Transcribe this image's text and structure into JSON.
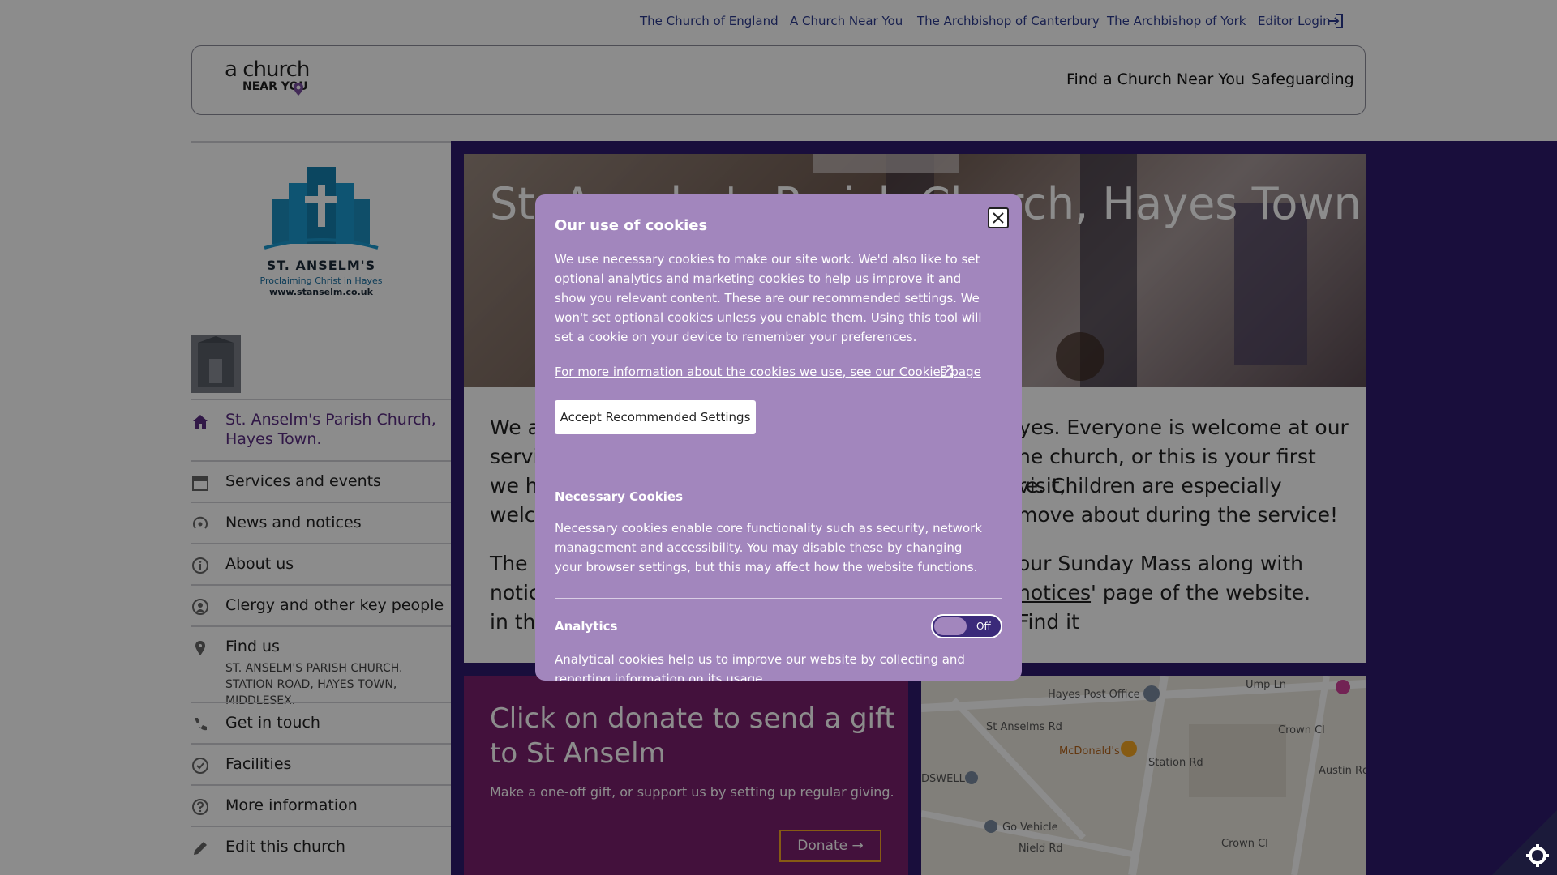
{
  "utility_nav": {
    "links": [
      "The Church of England",
      "A Church Near You",
      "The Archbishop of Canterbury",
      "The Archbishop of York",
      "Editor Login"
    ]
  },
  "header": {
    "brand_line1": "a church",
    "brand_line2": "NEAR YOU",
    "nav": [
      "Find a Church Near You",
      "Safeguarding"
    ]
  },
  "church_logo": {
    "name": "ST. ANSELM'S",
    "tagline": "Proclaiming Christ in Hayes",
    "website": "www.stanselm.co.uk"
  },
  "sidebar": {
    "items": [
      {
        "label": "St. Anselm's Parish Church, Hayes Town.",
        "icon": "home-icon"
      },
      {
        "label": "Services and events",
        "icon": "calendar-icon"
      },
      {
        "label": "News and notices",
        "icon": "broadcast-icon"
      },
      {
        "label": "About us",
        "icon": "info-icon"
      },
      {
        "label": "Clergy and other key people",
        "icon": "person-icon"
      },
      {
        "label": "Find us",
        "icon": "map-pin-icon",
        "sub": "ST. ANSELM'S PARISH CHURCH. STATION ROAD, HAYES TOWN, MIDDLESEX."
      },
      {
        "label": "Get in touch",
        "icon": "phone-icon"
      },
      {
        "label": "Facilities",
        "icon": "check-circle-icon"
      },
      {
        "label": "More information",
        "icon": "question-icon"
      },
      {
        "label": "Edit this church",
        "icon": "pencil-icon"
      }
    ]
  },
  "hero": {
    "title": "St. Anselm's Parish Church, Hayes Town."
  },
  "intro": {
    "p1_visible_left": "We a",
    "p1_line2_left": "servi",
    "p1_line3_left": "we ho",
    "p1_line4_left": "welco",
    "p1_right_1": "Hayes. Everyone is welcome at our",
    "p1_right_2": "he church, or this is your first visit,",
    "p1_right_3": "re. Children are especially",
    "p1_right_4": "move about during the service!",
    "p2_left_1": "The p",
    "p2_left_2": "notic",
    "p2_left_3": "in the",
    "p2_right_1": "our Sunday Mass along with",
    "p2_right_2_link": "notices",
    "p2_right_2_rest": "' page of the website. Find it"
  },
  "donate": {
    "heading": "Click on donate to send a gift to St Anselm",
    "sub": "Make a one-off gift, or support us by setting up regular giving.",
    "button": "Donate"
  },
  "map": {
    "labels": [
      "Hayes Post Office",
      "McDonald's",
      "St Anselms Rd",
      "Station Rd",
      "Crown Cl",
      "Austin Rd",
      "Go Vehicle",
      "Nield Rd",
      "DSWELL",
      "Ump Ln",
      "Crown Cl"
    ]
  },
  "cookie_modal": {
    "title": "Our use of cookies",
    "body": "We use necessary cookies to make our site work. We'd also like to set optional analytics and marketing cookies to help us improve it and show you relevant content. These are our recommended settings. We won't set optional cookies unless you enable them. Using this tool will set a cookie on your device to remember your preferences.",
    "more_link": "For more information about the cookies we use, see our Cookies page",
    "accept_button": "Accept Recommended Settings",
    "necessary_title": "Necessary Cookies",
    "necessary_desc": "Necessary cookies enable core functionality such as security, network management and accessibility. You may disable these by changing your browser settings, but this may affect how the website functions.",
    "analytics_title": "Analytics",
    "analytics_toggle": "Off",
    "analytics_desc": "Analytical cookies help us to improve our website by collecting and reporting information on its usage."
  },
  "colors": {
    "purple_panel": "#2e1a6e",
    "donate_bg": "#7a1f6e",
    "modal_bg": "#a286bd",
    "link_blue": "#2b3a8f",
    "accent_orange": "#f5a623"
  }
}
